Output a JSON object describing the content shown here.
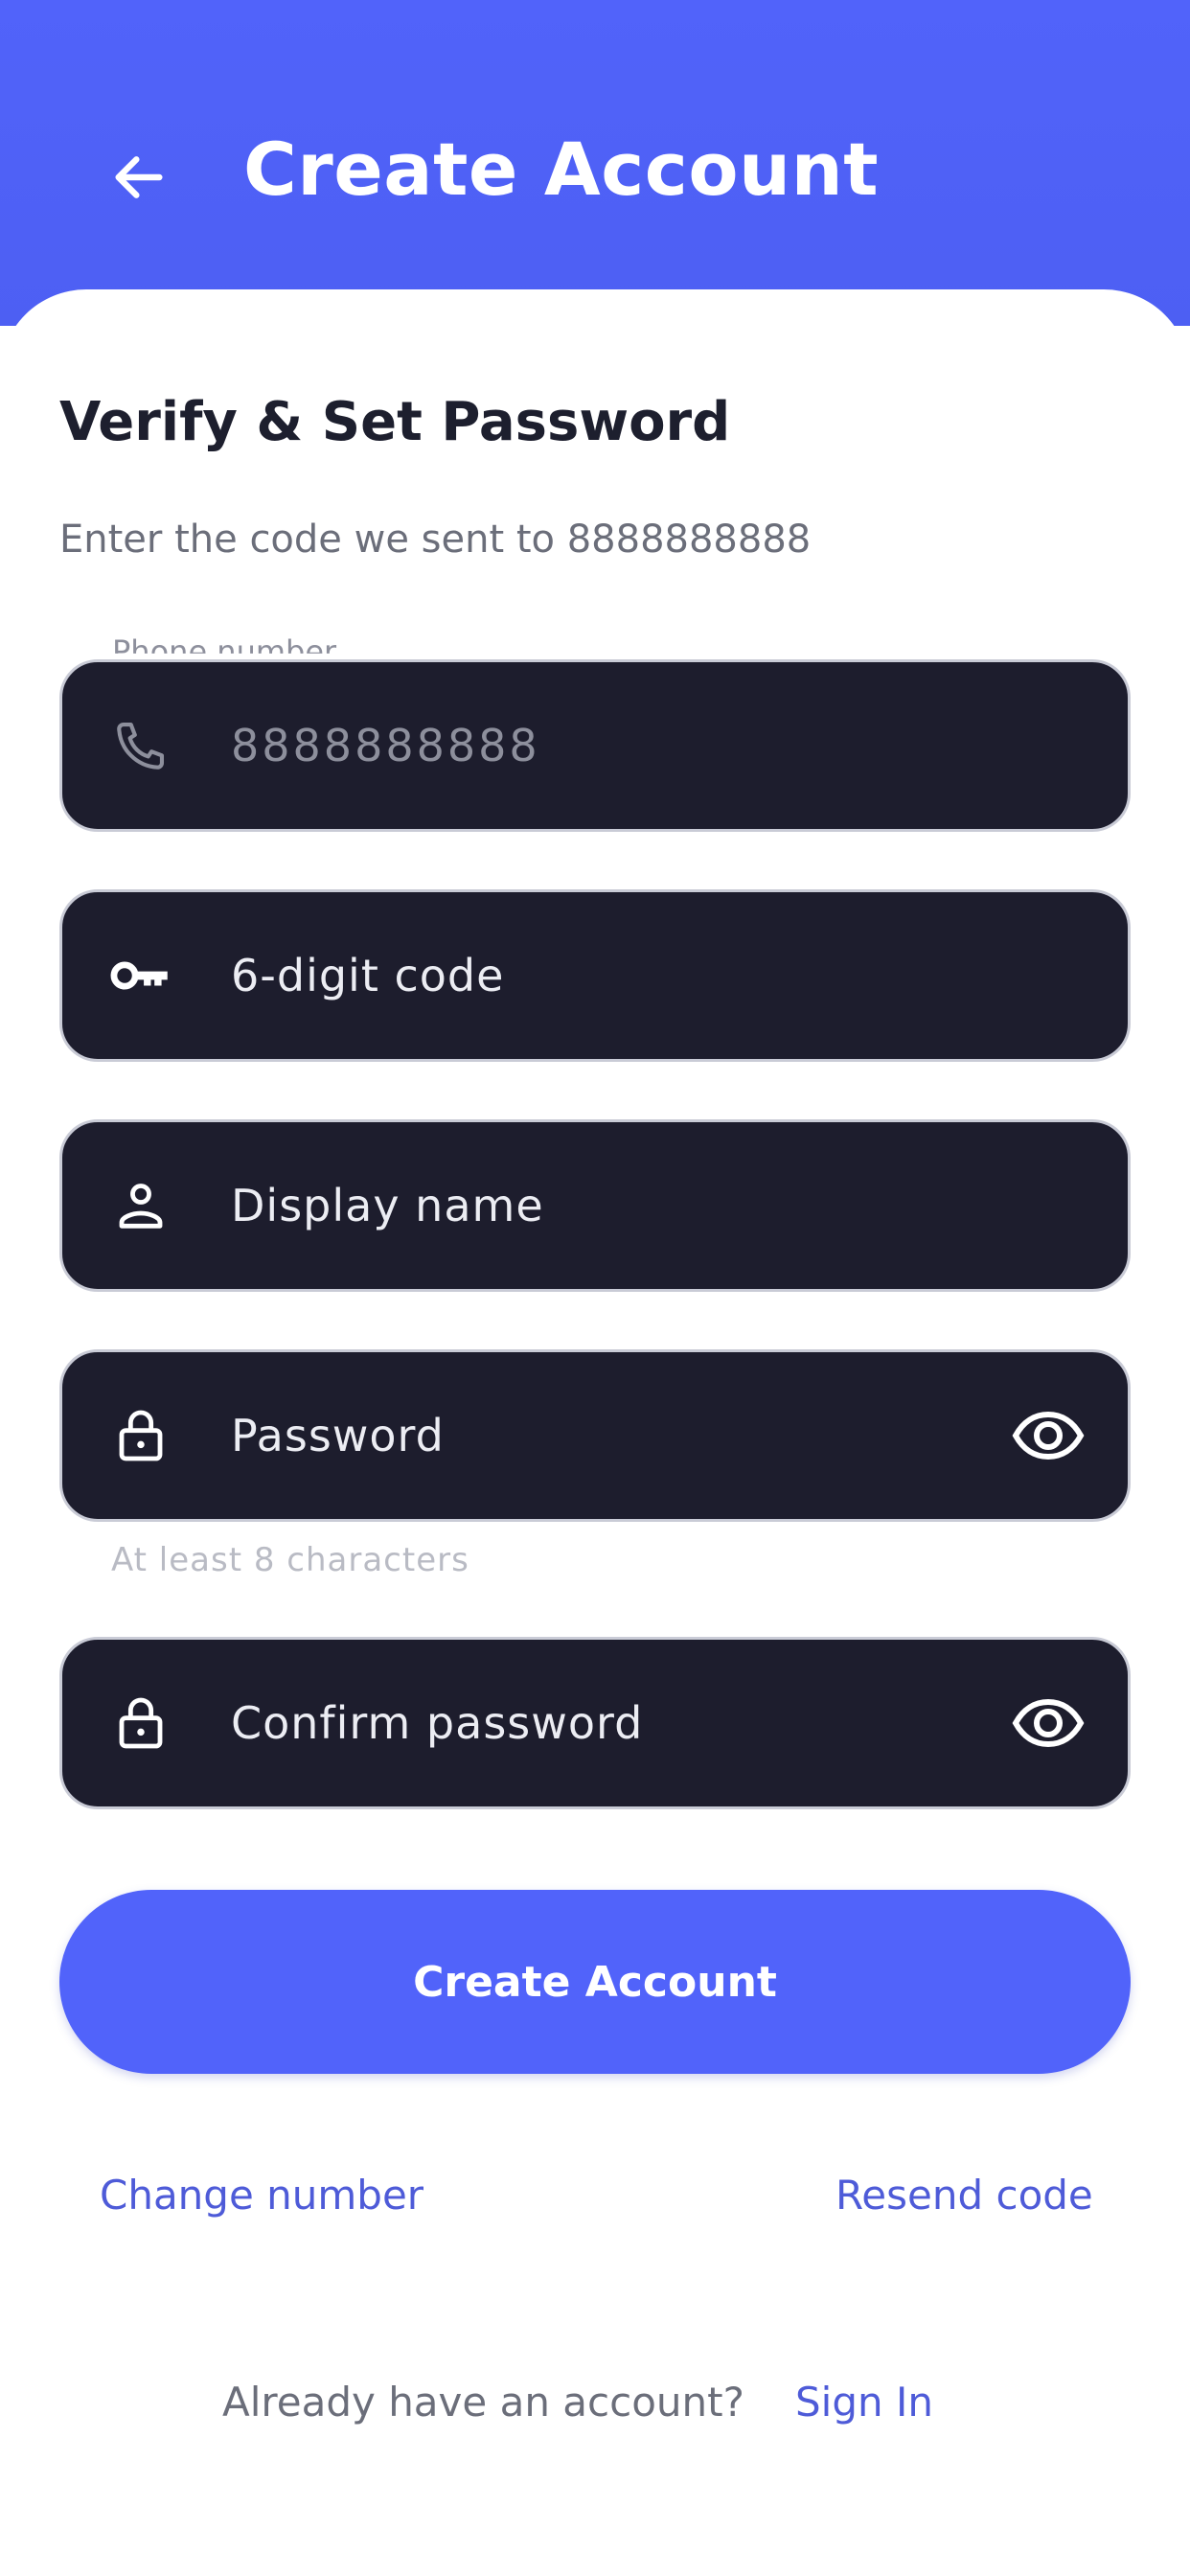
{
  "header": {
    "title": "Create Account",
    "back_icon": "arrow-left-icon",
    "color": "#5163fa"
  },
  "section": {
    "title": "Verify & Set Password",
    "subtitle": "Enter the code we sent to 8888888888"
  },
  "fields": {
    "phone": {
      "label": "Phone number",
      "value": "8888888888",
      "icon": "phone-icon"
    },
    "code": {
      "placeholder": "6-digit code",
      "icon": "key-icon"
    },
    "display_name": {
      "placeholder": "Display name",
      "icon": "person-icon"
    },
    "password": {
      "placeholder": "Password",
      "icon": "lock-icon",
      "toggle_icon": "eye-icon",
      "helper": "At least 8 characters"
    },
    "confirm_password": {
      "placeholder": "Confirm password",
      "icon": "lock-icon",
      "toggle_icon": "eye-icon"
    }
  },
  "actions": {
    "primary_label": "Create Account",
    "change_number": "Change number",
    "resend_code": "Resend code"
  },
  "footer": {
    "prompt": "Already have an account?",
    "sign_in": "Sign In"
  },
  "colors": {
    "accent": "#5163fa",
    "field_bg": "#1d1d2d",
    "link": "#4e5bd8"
  }
}
